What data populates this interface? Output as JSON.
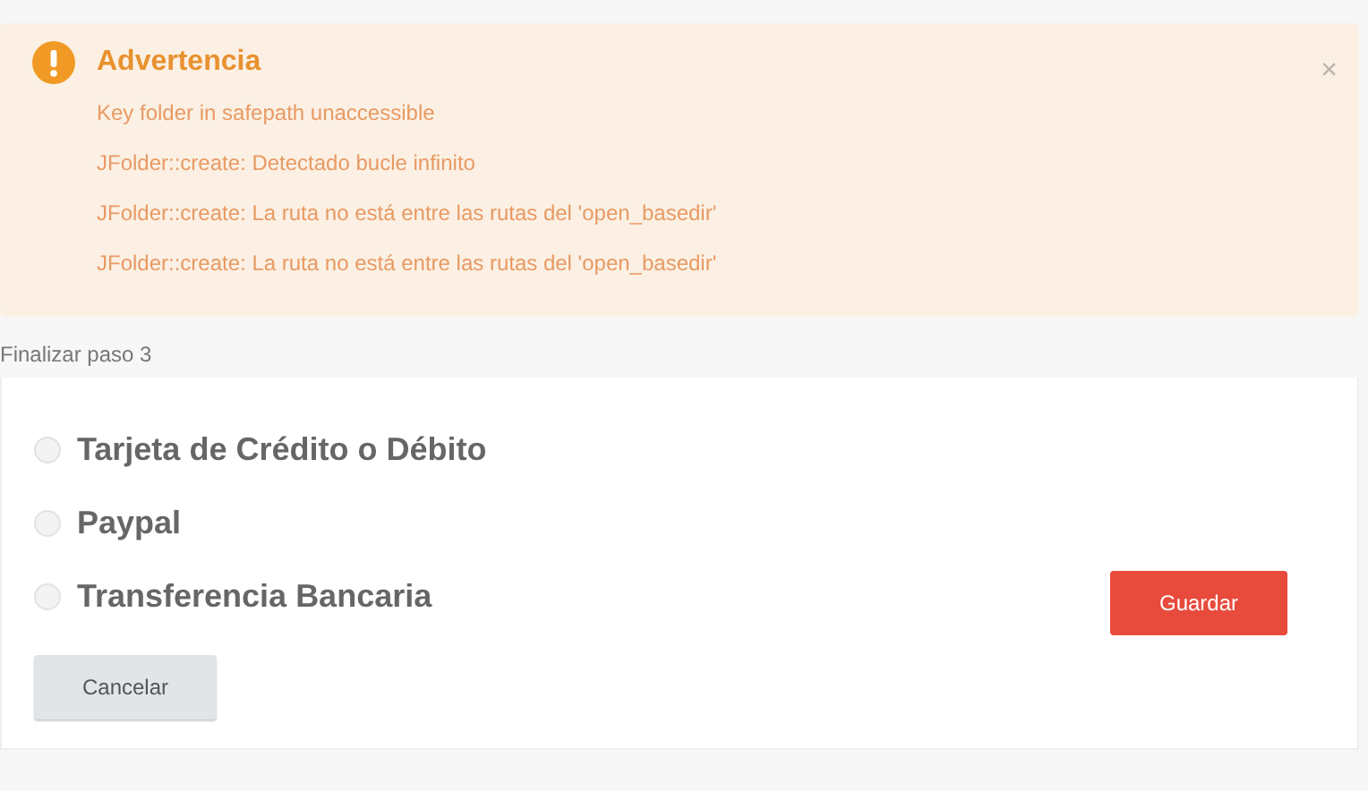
{
  "alert": {
    "title": "Advertencia",
    "close": "×",
    "messages": [
      "Key folder in safepath unaccessible",
      "JFolder::create: Detectado bucle infinito",
      "JFolder::create: La ruta no está entre las rutas del 'open_basedir'",
      "JFolder::create: La ruta no está entre las rutas del 'open_basedir'"
    ]
  },
  "step_label": "Finalizar paso 3",
  "payment_options": [
    {
      "label": "Tarjeta de Crédito o Débito",
      "selected": false
    },
    {
      "label": "Paypal",
      "selected": false
    },
    {
      "label": "Transferencia Bancaria",
      "selected": false
    }
  ],
  "buttons": {
    "save": "Guardar",
    "cancel": "Cancelar"
  }
}
